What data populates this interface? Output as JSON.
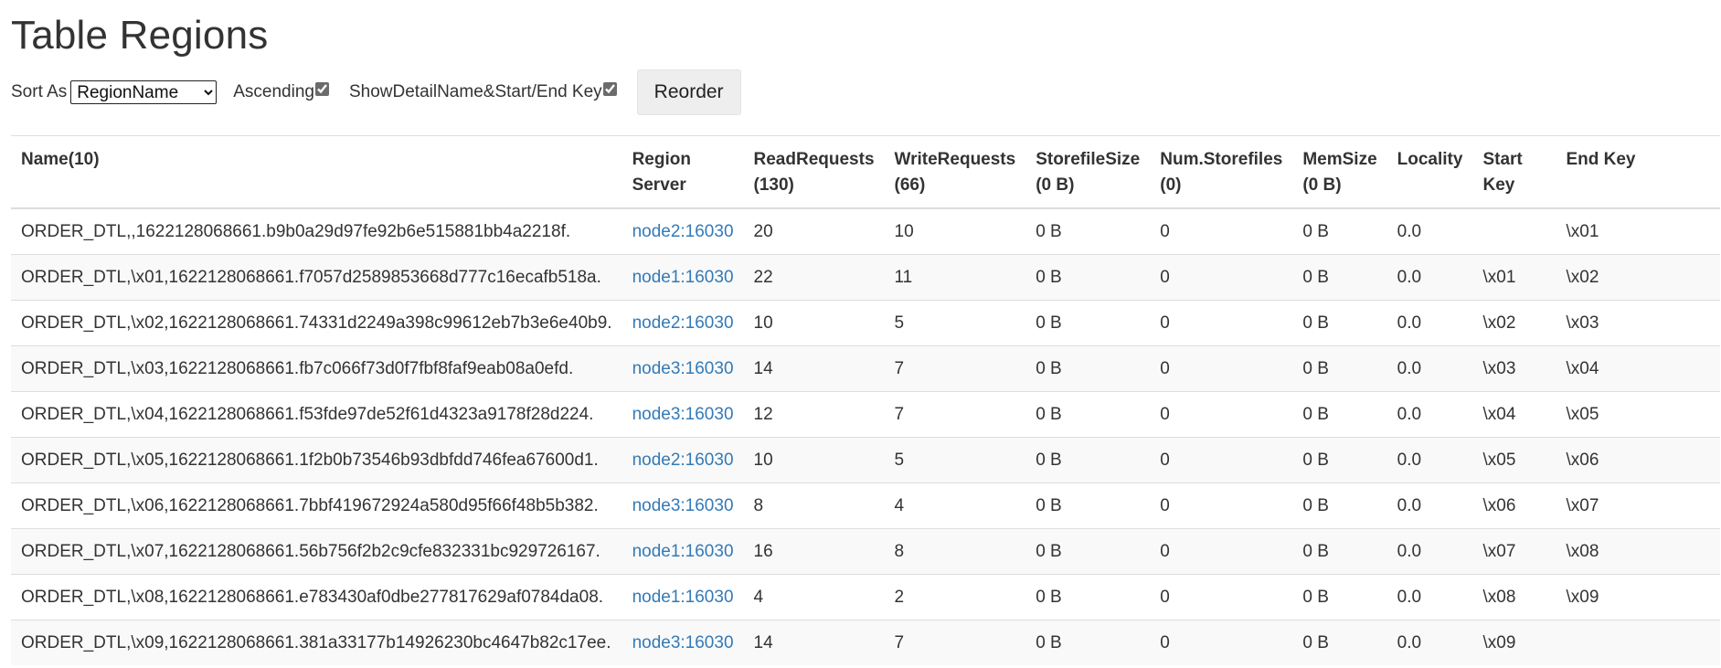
{
  "title": "Table Regions",
  "controls": {
    "sort_label": "Sort As",
    "sort_value": "RegionName",
    "ascending_label": "Ascending",
    "ascending_checked": true,
    "showdetail_label": "ShowDetailName&Start/End Key",
    "showdetail_checked": true,
    "reorder_label": "Reorder"
  },
  "columns": [
    {
      "line1": "Name(10)",
      "line2": ""
    },
    {
      "line1": "Region Server",
      "line2": ""
    },
    {
      "line1": "ReadRequests",
      "line2": "(130)"
    },
    {
      "line1": "WriteRequests",
      "line2": "(66)"
    },
    {
      "line1": "StorefileSize",
      "line2": "(0 B)"
    },
    {
      "line1": "Num.Storefiles",
      "line2": "(0)"
    },
    {
      "line1": "MemSize",
      "line2": "(0 B)"
    },
    {
      "line1": "Locality",
      "line2": ""
    },
    {
      "line1": "Start Key",
      "line2": ""
    },
    {
      "line1": "End Key",
      "line2": ""
    }
  ],
  "rows": [
    {
      "name": "ORDER_DTL,,1622128068661.b9b0a29d97fe92b6e515881bb4a2218f.",
      "server": "node2:16030",
      "read": "20",
      "write": "10",
      "storefile_size": "0 B",
      "num_storefiles": "0",
      "mem_size": "0 B",
      "locality": "0.0",
      "start_key": "",
      "end_key": "\\x01"
    },
    {
      "name": "ORDER_DTL,\\x01,1622128068661.f7057d2589853668d777c16ecafb518a.",
      "server": "node1:16030",
      "read": "22",
      "write": "11",
      "storefile_size": "0 B",
      "num_storefiles": "0",
      "mem_size": "0 B",
      "locality": "0.0",
      "start_key": "\\x01",
      "end_key": "\\x02"
    },
    {
      "name": "ORDER_DTL,\\x02,1622128068661.74331d2249a398c99612eb7b3e6e40b9.",
      "server": "node2:16030",
      "read": "10",
      "write": "5",
      "storefile_size": "0 B",
      "num_storefiles": "0",
      "mem_size": "0 B",
      "locality": "0.0",
      "start_key": "\\x02",
      "end_key": "\\x03"
    },
    {
      "name": "ORDER_DTL,\\x03,1622128068661.fb7c066f73d0f7fbf8faf9eab08a0efd.",
      "server": "node3:16030",
      "read": "14",
      "write": "7",
      "storefile_size": "0 B",
      "num_storefiles": "0",
      "mem_size": "0 B",
      "locality": "0.0",
      "start_key": "\\x03",
      "end_key": "\\x04"
    },
    {
      "name": "ORDER_DTL,\\x04,1622128068661.f53fde97de52f61d4323a9178f28d224.",
      "server": "node3:16030",
      "read": "12",
      "write": "7",
      "storefile_size": "0 B",
      "num_storefiles": "0",
      "mem_size": "0 B",
      "locality": "0.0",
      "start_key": "\\x04",
      "end_key": "\\x05"
    },
    {
      "name": "ORDER_DTL,\\x05,1622128068661.1f2b0b73546b93dbfdd746fea67600d1.",
      "server": "node2:16030",
      "read": "10",
      "write": "5",
      "storefile_size": "0 B",
      "num_storefiles": "0",
      "mem_size": "0 B",
      "locality": "0.0",
      "start_key": "\\x05",
      "end_key": "\\x06"
    },
    {
      "name": "ORDER_DTL,\\x06,1622128068661.7bbf419672924a580d95f66f48b5b382.",
      "server": "node3:16030",
      "read": "8",
      "write": "4",
      "storefile_size": "0 B",
      "num_storefiles": "0",
      "mem_size": "0 B",
      "locality": "0.0",
      "start_key": "\\x06",
      "end_key": "\\x07"
    },
    {
      "name": "ORDER_DTL,\\x07,1622128068661.56b756f2b2c9cfe832331bc929726167.",
      "server": "node1:16030",
      "read": "16",
      "write": "8",
      "storefile_size": "0 B",
      "num_storefiles": "0",
      "mem_size": "0 B",
      "locality": "0.0",
      "start_key": "\\x07",
      "end_key": "\\x08"
    },
    {
      "name": "ORDER_DTL,\\x08,1622128068661.e783430af0dbe277817629af0784da08.",
      "server": "node1:16030",
      "read": "4",
      "write": "2",
      "storefile_size": "0 B",
      "num_storefiles": "0",
      "mem_size": "0 B",
      "locality": "0.0",
      "start_key": "\\x08",
      "end_key": "\\x09"
    },
    {
      "name": "ORDER_DTL,\\x09,1622128068661.381a33177b14926230bc4647b82c17ee.",
      "server": "node3:16030",
      "read": "14",
      "write": "7",
      "storefile_size": "0 B",
      "num_storefiles": "0",
      "mem_size": "0 B",
      "locality": "0.0",
      "start_key": "\\x09",
      "end_key": ""
    }
  ]
}
